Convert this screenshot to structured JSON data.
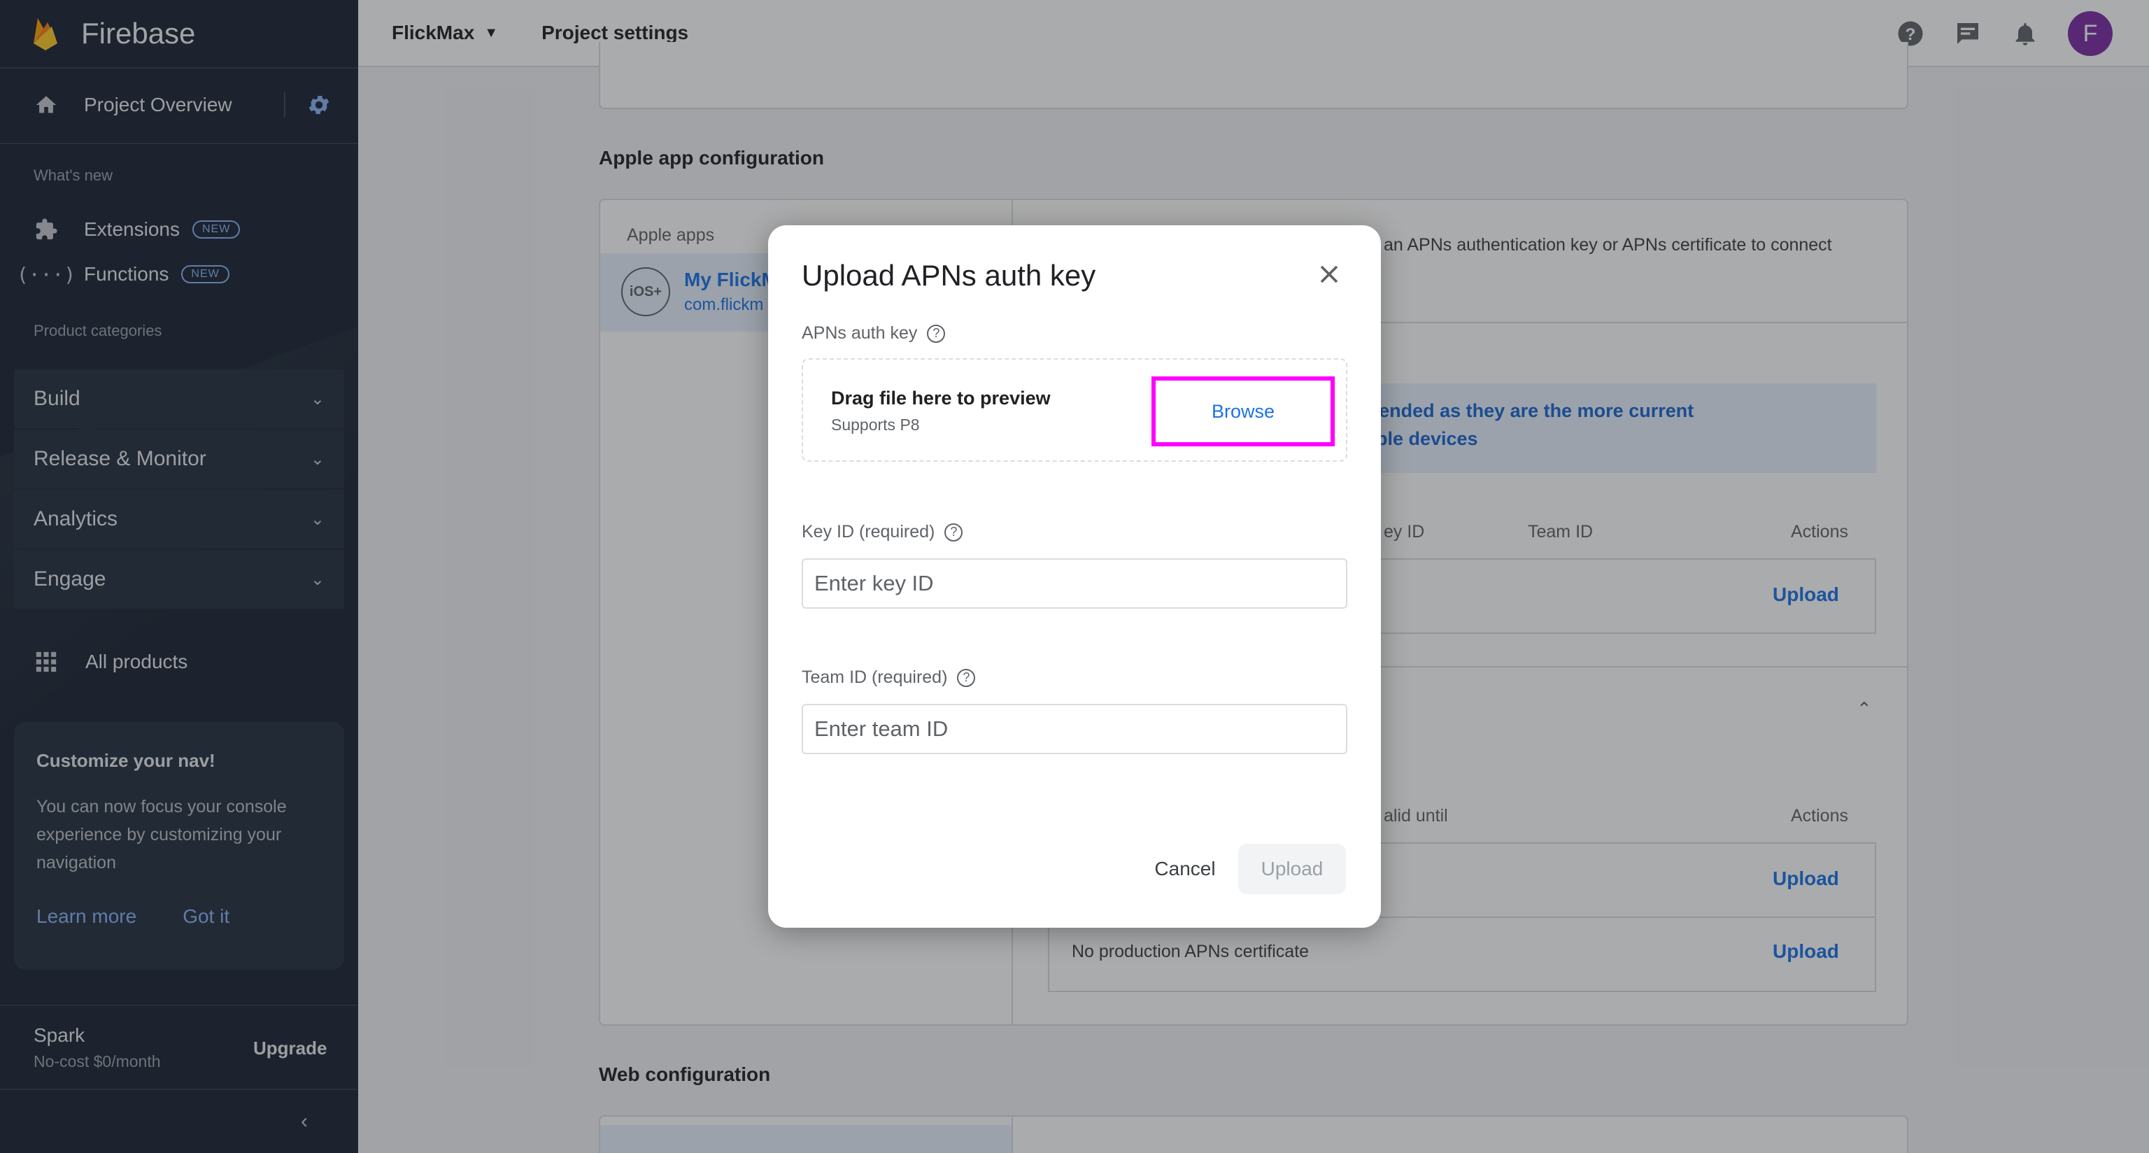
{
  "sidebar": {
    "brand": "Firebase",
    "project_overview": "Project Overview",
    "whats_new_caption": "What's new",
    "extensions": {
      "label": "Extensions",
      "badge": "NEW"
    },
    "functions": {
      "label": "Functions",
      "badge": "NEW"
    },
    "product_categories_caption": "Product categories",
    "categories": [
      "Build",
      "Release & Monitor",
      "Analytics",
      "Engage"
    ],
    "all_products": "All products",
    "promo": {
      "title": "Customize your nav!",
      "body": "You can now focus your console experience by customizing your navigation",
      "learn_more": "Learn more",
      "got_it": "Got it"
    },
    "plan": {
      "name": "Spark",
      "price": "No-cost $0/month",
      "upgrade": "Upgrade"
    }
  },
  "header": {
    "project_name": "FlickMax",
    "page": "Project settings",
    "avatar_letter": "F"
  },
  "main": {
    "apple_section_title": "Apple app configuration",
    "apple_apps_caption": "Apple apps",
    "app_name": "My FlickM",
    "app_bundle": "com.flickm",
    "app_badge": "iOS+",
    "description_fragment": "an APNs authentication key or APNs certificate to connect",
    "banner_line1": "is recommended as they are the more current",
    "banner_line2": "ions to Apple devices",
    "table1_headers": {
      "key_id": "ey ID",
      "team_id": "Team ID",
      "actions": "Actions"
    },
    "table1_upload": "Upload",
    "table2_headers": {
      "valid_until": "alid until",
      "actions": "Actions"
    },
    "table2_upload1": "Upload",
    "no_prod_cert": "No production APNs certificate",
    "table2_upload2": "Upload",
    "web_section_title": "Web configuration"
  },
  "dialog": {
    "title": "Upload APNs auth key",
    "auth_key_label": "APNs auth key",
    "dropzone_main": "Drag file here to preview",
    "dropzone_sub": "Supports P8",
    "browse": "Browse",
    "key_id_label": "Key ID (required)",
    "key_id_placeholder": "Enter key ID",
    "team_id_label": "Team ID (required)",
    "team_id_placeholder": "Enter team ID",
    "cancel": "Cancel",
    "upload": "Upload"
  },
  "colors": {
    "sidebar_bg": "#1a2434",
    "accent": "#1a73e8",
    "highlight": "#ff00ff",
    "avatar_bg": "#7b2da6"
  }
}
